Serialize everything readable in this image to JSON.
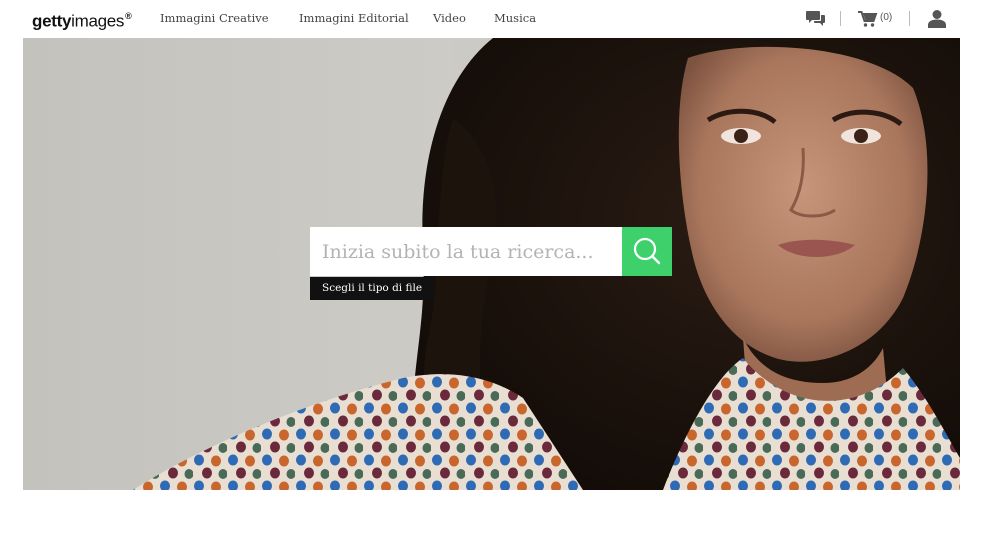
{
  "brand": {
    "logo_bold": "getty",
    "logo_light": "images",
    "logo_mark": "®"
  },
  "nav": {
    "items": [
      {
        "label": "Immagini Creative"
      },
      {
        "label": "Immagini Editorial"
      },
      {
        "label": "Video"
      },
      {
        "label": "Musica"
      }
    ]
  },
  "utility": {
    "chat_icon": "speech-bubbles-icon",
    "cart_icon": "shopping-cart-icon",
    "cart_count": "(0)",
    "user_icon": "user-account-icon"
  },
  "hero": {
    "search": {
      "placeholder": "Inizia subito la tua ricerca..."
    },
    "search_button_icon": "search-icon",
    "file_type_label": "Scegli il tipo di file"
  },
  "colors": {
    "accent_green": "#3ed06b",
    "file_type_bg": "#111111",
    "nav_text": "#444444"
  }
}
